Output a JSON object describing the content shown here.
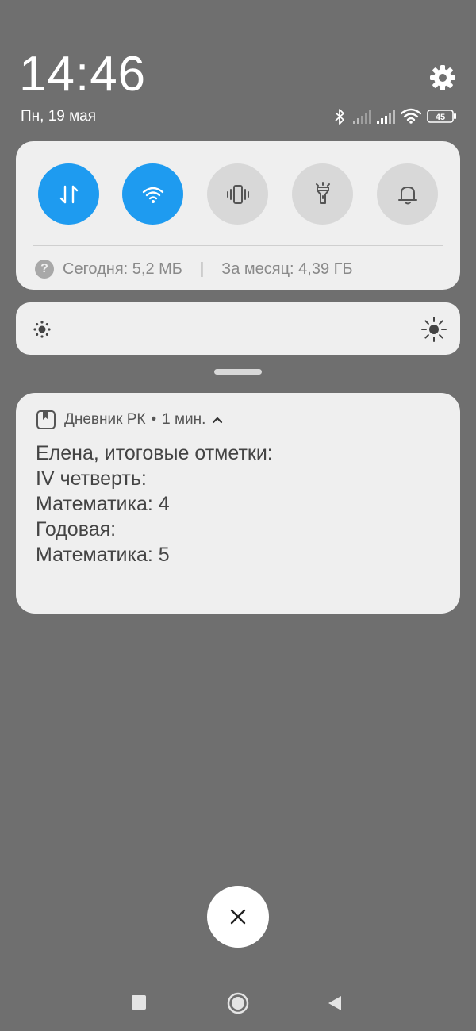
{
  "status_bar": {
    "time": "14:46",
    "date": "Пн, 19 мая",
    "battery_level": "45",
    "icons": [
      "bluetooth-icon",
      "signal-icon",
      "signal-icon",
      "wifi-icon",
      "battery-icon"
    ]
  },
  "quick_settings": {
    "tiles": [
      {
        "name": "mobile-data",
        "icon": "mobile-data-icon",
        "active": true
      },
      {
        "name": "wifi",
        "icon": "wifi-icon",
        "active": true
      },
      {
        "name": "vibrate",
        "icon": "vibrate-icon",
        "active": false
      },
      {
        "name": "flashlight",
        "icon": "flashlight-icon",
        "active": false
      },
      {
        "name": "notifications",
        "icon": "bell-icon",
        "active": false
      }
    ],
    "usage_today": "Сегодня: 5,2 МБ",
    "separator": "|",
    "usage_month": "За месяц: 4,39 ГБ",
    "help_glyph": "?"
  },
  "notification": {
    "app_name": "Дневник РК",
    "dot": "•",
    "time_ago": "1 мин.",
    "lines": [
      "Елена, итоговые отметки:",
      "IV четверть:",
      "Математика: 4",
      "Годовая:",
      "Математика: 5"
    ]
  },
  "colors": {
    "background": "#6f6f6f",
    "panel": "#efefef",
    "accent": "#1e9bf0",
    "inactive_tile": "#d8d8d8"
  }
}
